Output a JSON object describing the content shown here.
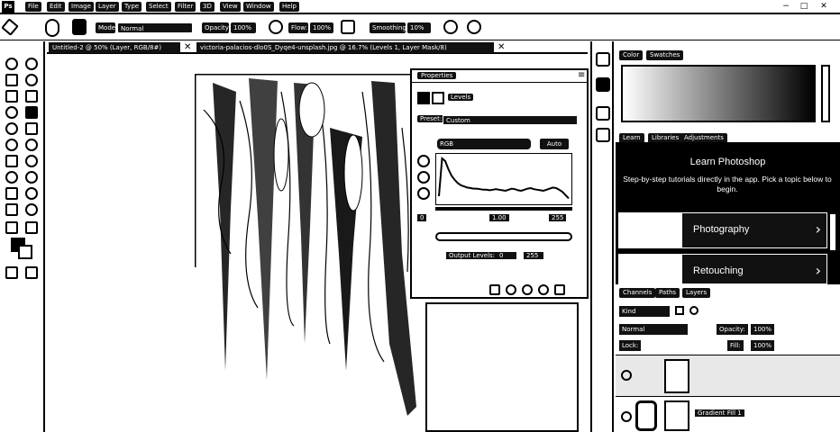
{
  "menu": {
    "items": [
      "File",
      "Edit",
      "Image",
      "Layer",
      "Type",
      "Select",
      "Filter",
      "3D",
      "View",
      "Window",
      "Help"
    ]
  },
  "options": {
    "mode_label": "Mode:",
    "mode_value": "Normal",
    "opacity_label": "Opacity:",
    "opacity_value": "100%",
    "flow_label": "Flow:",
    "flow_value": "100%",
    "smoothing_label": "Smoothing:",
    "smoothing_value": "10%"
  },
  "doc_tabs": [
    "Untitled-2 @ 50% (Layer, RGB/8#)",
    "victoria-palacios-dlo0S_Dyqe4-unsplash.jpg @ 16.7% (Levels 1, Layer Mask/8)"
  ],
  "properties": {
    "title": "Properties",
    "section": "Levels",
    "preset_label": "Preset:",
    "preset_value": "Custom",
    "channel_value": "RGB",
    "auto_label": "Auto",
    "input_black": "0",
    "input_gamma": "1.00",
    "input_white": "255",
    "output_label": "Output Levels:",
    "output_black": "0",
    "output_white": "255"
  },
  "color_panel": {
    "tabs": [
      "Color",
      "Swatches"
    ]
  },
  "learn_panel": {
    "tabs": [
      "Learn",
      "Libraries",
      "Adjustments"
    ],
    "title": "Learn Photoshop",
    "subtitle": "Step-by-step tutorials directly in the app. Pick a topic below to begin.",
    "cards": [
      {
        "label": "Photography"
      },
      {
        "label": "Retouching"
      }
    ]
  },
  "layers_panel": {
    "tabs": [
      "Channels",
      "Paths",
      "Layers"
    ],
    "kind_label": "Kind",
    "blend_value": "Normal",
    "opacity_label": "Opacity:",
    "opacity_value": "100%",
    "lock_label": "Lock:",
    "fill_label": "Fill:",
    "fill_value": "100%",
    "layers": [
      {
        "name": ""
      },
      {
        "name": "Gradient Fill 1"
      }
    ]
  },
  "histogram": {
    "description_values": [
      10,
      80,
      75,
      60,
      48,
      40,
      34,
      30,
      28,
      26,
      25,
      24,
      24,
      23,
      22,
      22,
      21,
      22,
      23,
      22,
      21,
      20,
      22,
      24,
      23,
      21,
      20,
      22,
      24,
      25,
      23,
      22,
      21,
      20,
      22,
      24,
      26,
      25,
      22,
      18,
      12,
      6
    ]
  }
}
